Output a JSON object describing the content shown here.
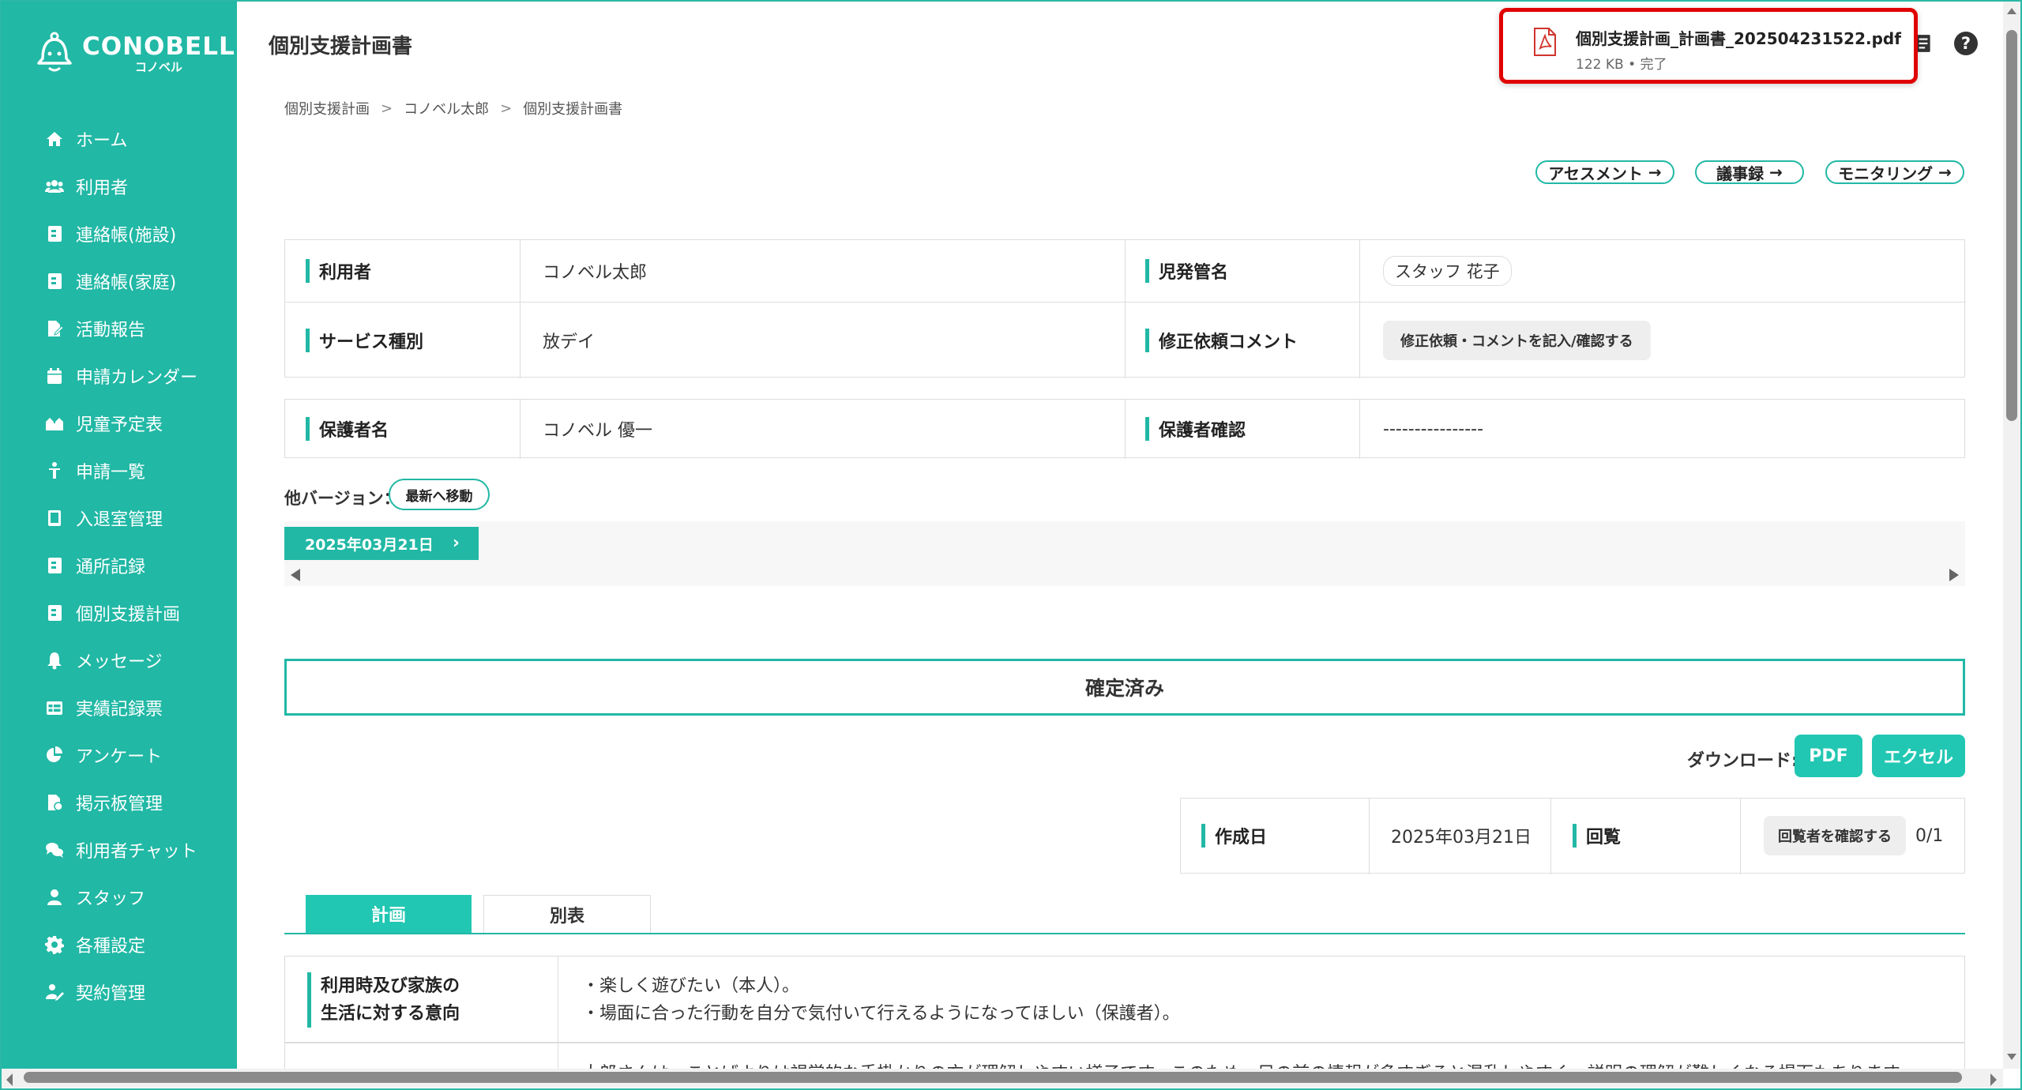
{
  "brand": {
    "name": "CONOBELL",
    "kana": "コノベル"
  },
  "sidebar": {
    "items": [
      {
        "label": "ホーム",
        "icon": "home-icon"
      },
      {
        "label": "利用者",
        "icon": "users-icon"
      },
      {
        "label": "連絡帳(施設)",
        "icon": "contact-book-icon"
      },
      {
        "label": "連絡帳(家庭)",
        "icon": "contact-book-icon"
      },
      {
        "label": "活動報告",
        "icon": "file-edit-icon"
      },
      {
        "label": "申請カレンダー",
        "icon": "calendar-icon"
      },
      {
        "label": "児童予定表",
        "icon": "schedule-icon"
      },
      {
        "label": "申請一覧",
        "icon": "child-icon"
      },
      {
        "label": "入退室管理",
        "icon": "tablet-icon"
      },
      {
        "label": "通所記録",
        "icon": "record-icon"
      },
      {
        "label": "個別支援計画",
        "icon": "plan-icon"
      },
      {
        "label": "メッセージ",
        "icon": "bell-icon"
      },
      {
        "label": "実績記録票",
        "icon": "table-icon"
      },
      {
        "label": "アンケート",
        "icon": "pie-chart-icon"
      },
      {
        "label": "掲示板管理",
        "icon": "board-icon"
      },
      {
        "label": "利用者チャット",
        "icon": "chat-icon"
      },
      {
        "label": "スタッフ",
        "icon": "staff-icon"
      },
      {
        "label": "各種設定",
        "icon": "gear-icon"
      },
      {
        "label": "契約管理",
        "icon": "contract-icon"
      }
    ]
  },
  "header": {
    "title": "個別支援計画書"
  },
  "download_popup": {
    "filename": "個別支援計画_計画書_202504231522.pdf",
    "meta": "122 KB • 完了"
  },
  "breadcrumb": [
    "個別支援計画",
    "コノベル太郎",
    "個別支援計画書"
  ],
  "links": {
    "assessment": "アセスメント",
    "minutes": "議事録",
    "monitoring": "モニタリング"
  },
  "info": {
    "user_label": "利用者",
    "user_value": "コノベル太郎",
    "manager_label": "児発管名",
    "manager_value": "スタッフ 花子",
    "service_label": "サービス種別",
    "service_value": "放デイ",
    "comment_label": "修正依頼コメント",
    "comment_button": "修正依頼・コメントを記入/確認する",
    "guardian_label": "保護者名",
    "guardian_value": "コノベル 優一",
    "guardian_confirm_label": "保護者確認",
    "guardian_confirm_value": "----------------"
  },
  "versions": {
    "label": "他バージョン：",
    "to_latest": "最新へ移動",
    "items": [
      "2025年03月21日"
    ]
  },
  "status": "確定済み",
  "download": {
    "label": "ダウンロード:",
    "pdf": "PDF",
    "excel": "エクセル"
  },
  "meta": {
    "created_label": "作成日",
    "created_value": "2025年03月21日",
    "circulation_label": "回覧",
    "circulation_button": "回覧者を確認する",
    "circulation_count": "0/1"
  },
  "tabs": [
    "計画",
    "別表"
  ],
  "plan": {
    "row1_label_line1": "利用時及び家族の",
    "row1_label_line2": "生活に対する意向",
    "row1_value_line1": "・楽しく遊びたい（本人）。",
    "row1_value_line2": "・場面に合った行動を自分で気付いて行えるようになってほしい（保護者）。",
    "row2_partial": "大郎さんは、ことばよりは視覚的な手掛かりの方が理解しやすい様子です。このため、目の前の情報が多すぎると混乱しやすく、説明の理解が難しくなる場面もあります。"
  },
  "colors": {
    "accent": "#21b8a5",
    "alert": "#e00000"
  }
}
